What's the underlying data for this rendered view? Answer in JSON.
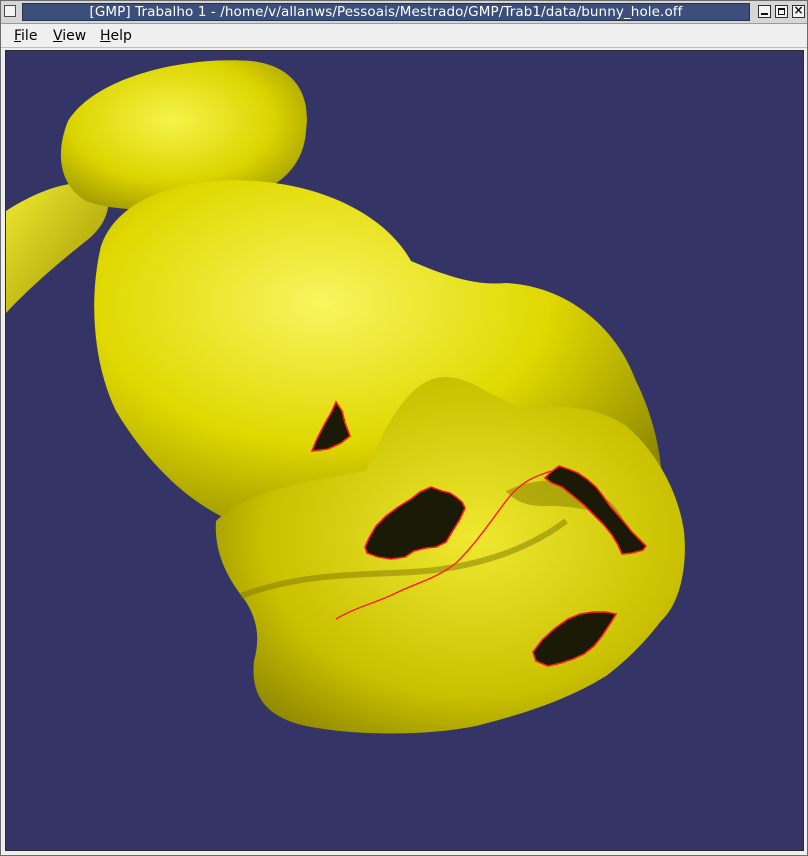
{
  "window": {
    "title": "[GMP] Trabalho 1 - /home/v/allanws/Pessoais/Mestrado/GMP/Trab1/data/bunny_hole.off",
    "close_glyph": "×"
  },
  "menubar": {
    "items": [
      {
        "mnemonic": "F",
        "rest": "ile"
      },
      {
        "mnemonic": "V",
        "rest": "iew"
      },
      {
        "mnemonic": "H",
        "rest": "elp"
      }
    ]
  },
  "viewport": {
    "background_color": "#343466",
    "mesh_color": "#e6e600",
    "hole_fill_color": "#1a1a06",
    "boundary_color": "#ff1a1a",
    "holes": 4
  }
}
